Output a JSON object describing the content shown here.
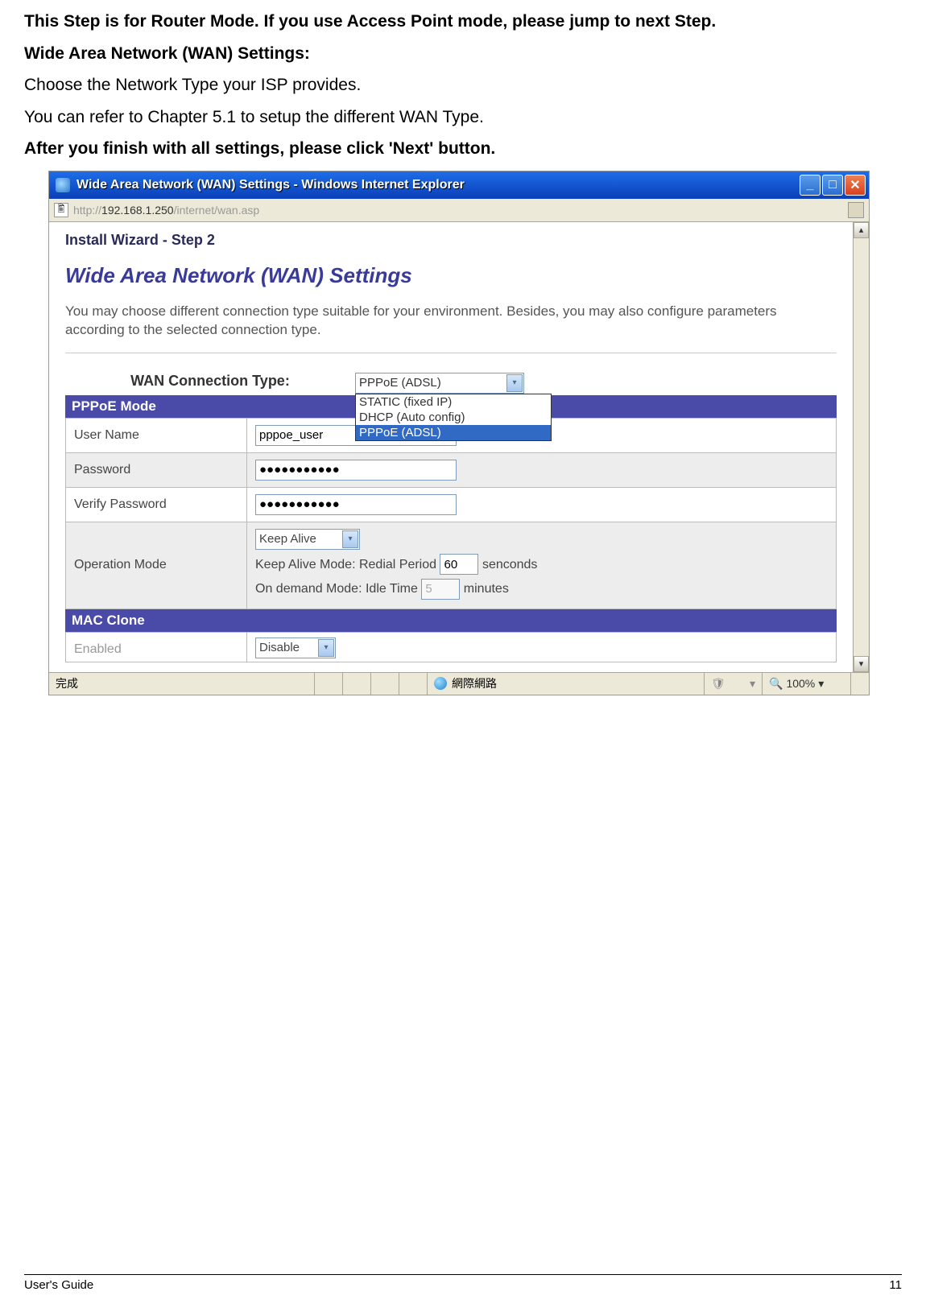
{
  "doc": {
    "line1": "This Step is for Router Mode. If you use Access Point mode, please jump to next Step.",
    "line2": "Wide Area Network (WAN) Settings:",
    "line3": "Choose the Network Type your ISP provides.",
    "line4": "You can refer to Chapter 5.1 to setup the different WAN Type.",
    "line5": "After you finish with all settings, please click 'Next' button."
  },
  "browser": {
    "title": "Wide Area Network (WAN) Settings - Windows Internet Explorer",
    "url_prefix": "http://",
    "url_host": "192.168.1.250",
    "url_path": "/internet/wan.asp",
    "status_left": "完成",
    "status_zone": "網際網路",
    "zoom": "100%"
  },
  "page": {
    "wizard_step": "Install Wizard - Step 2",
    "heading": "Wide Area Network (WAN) Settings",
    "desc": "You may choose different connection type suitable for your environment. Besides, you may also configure parameters according to the selected connection type.",
    "conn_type_label": "WAN Connection Type:",
    "conn_type_selected": "PPPoE (ADSL)",
    "dropdown": {
      "opt1": "STATIC (fixed IP)",
      "opt2": "DHCP (Auto config)",
      "opt3": "PPPoE (ADSL)"
    },
    "section_pppoe": "PPPoE Mode",
    "user_name_label": "User Name",
    "user_name_value": "pppoe_user",
    "password_label": "Password",
    "password_value": "●●●●●●●●●●●",
    "verify_password_label": "Verify Password",
    "verify_password_value": "●●●●●●●●●●●",
    "op_mode_label": "Operation Mode",
    "op_mode_select": "Keep Alive",
    "op_mode_text1a": "Keep Alive Mode: Redial Period",
    "op_mode_redial": "60",
    "op_mode_text1b": "senconds",
    "op_mode_text2a": "On demand Mode: Idle Time",
    "op_mode_idle": "5",
    "op_mode_text2b": "minutes",
    "section_mac": "MAC Clone",
    "enabled_label": "Enabled",
    "enabled_value": "Disable"
  },
  "footer": {
    "left": "User's Guide",
    "right": "11"
  }
}
